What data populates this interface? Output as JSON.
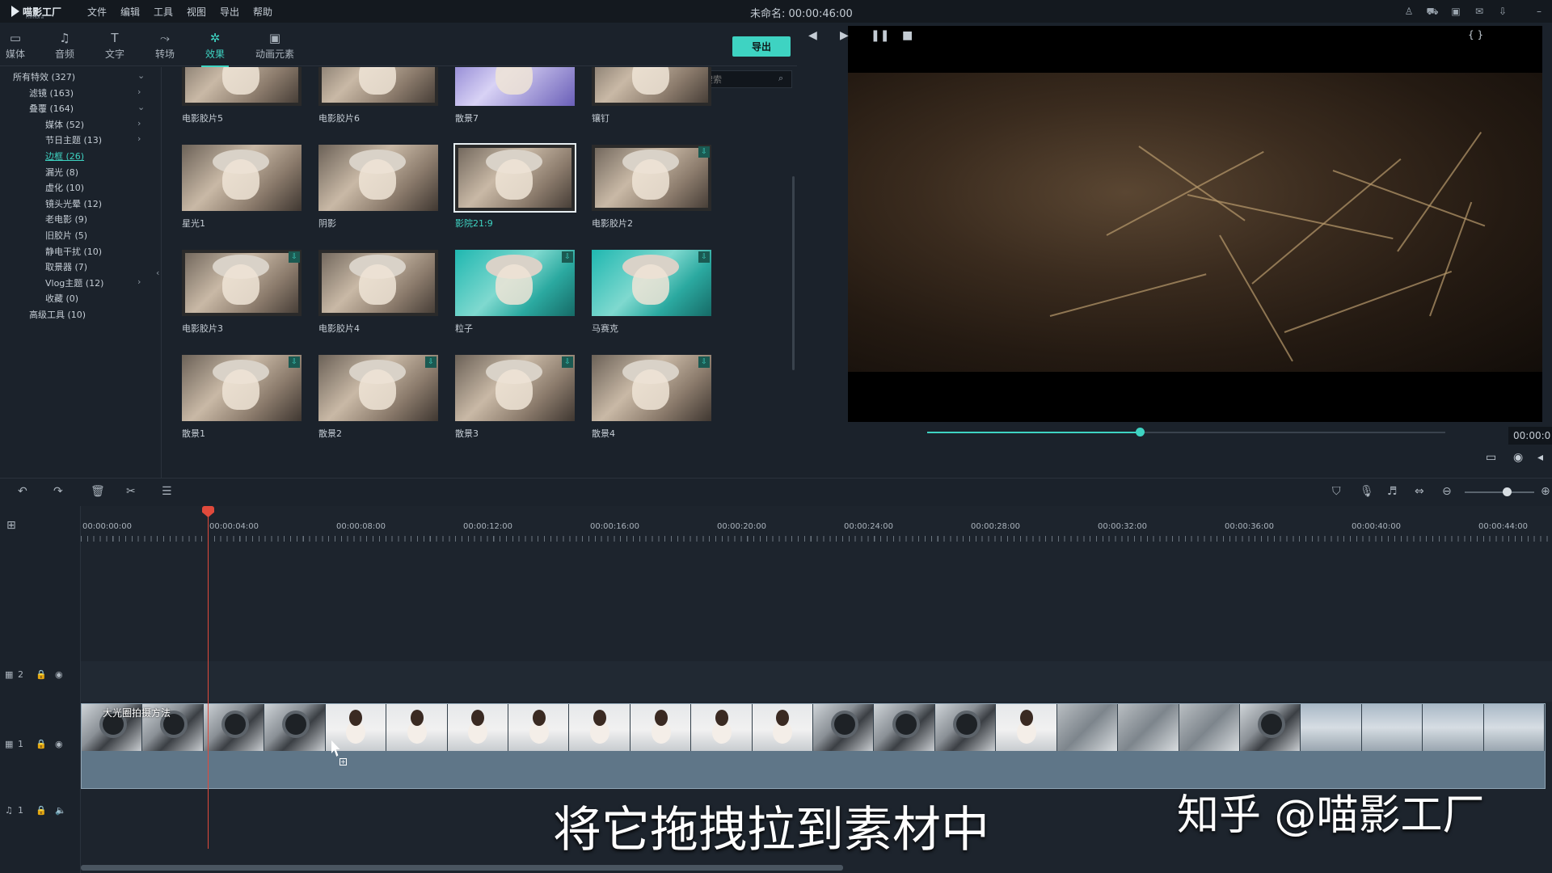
{
  "app": {
    "logo_text": "喵影工厂",
    "logo_sub": "Filmora"
  },
  "menu": [
    "文件",
    "编辑",
    "工具",
    "视图",
    "导出",
    "帮助"
  ],
  "doc_title": "未命名: 00:00:46:00",
  "toolbar": {
    "tools": [
      {
        "label": "媒体",
        "icon": "▭"
      },
      {
        "label": "音频",
        "icon": "♫"
      },
      {
        "label": "文字",
        "icon": "T"
      },
      {
        "label": "转场",
        "icon": "⤳"
      },
      {
        "label": "效果",
        "icon": "✲"
      },
      {
        "label": "动画元素",
        "icon": "▣"
      }
    ],
    "active_tool": "效果",
    "export_label": "导出"
  },
  "sidebar": {
    "categories": [
      {
        "label": "所有特效 (327)",
        "chevron": "⌄"
      },
      {
        "label": "滤镜 (163)",
        "chevron": "›"
      },
      {
        "label": "叠覆 (164)",
        "chevron": "⌄"
      },
      {
        "label": "媒体 (52)",
        "chevron": "›"
      },
      {
        "label": "节日主题 (13)",
        "chevron": "›"
      },
      {
        "label": "边框 (26)",
        "chevron": ""
      },
      {
        "label": "漏光 (8)",
        "chevron": ""
      },
      {
        "label": "虚化 (10)",
        "chevron": ""
      },
      {
        "label": "镜头光晕 (12)",
        "chevron": ""
      },
      {
        "label": "老电影 (9)",
        "chevron": ""
      },
      {
        "label": "旧胶片 (5)",
        "chevron": ""
      },
      {
        "label": "静电干扰 (10)",
        "chevron": ""
      },
      {
        "label": "取景器 (7)",
        "chevron": ""
      },
      {
        "label": "Vlog主题 (12)",
        "chevron": "›"
      },
      {
        "label": "收藏 (0)",
        "chevron": ""
      },
      {
        "label": "高级工具 (10)",
        "chevron": ""
      }
    ],
    "selected": "边框 (26)"
  },
  "grid": {
    "search_placeholder": "搜索",
    "items": [
      {
        "label": "电影胶片5",
        "style": "frame",
        "download": false
      },
      {
        "label": "电影胶片6",
        "style": "frame",
        "download": false
      },
      {
        "label": "散景7",
        "style": "bokeh",
        "download": false
      },
      {
        "label": "镶钉",
        "style": "frame",
        "download": false
      },
      {
        "label": "星光1",
        "style": "plain",
        "download": false
      },
      {
        "label": "阴影",
        "style": "plain",
        "download": false
      },
      {
        "label": "影院21:9",
        "style": "selected",
        "download": false
      },
      {
        "label": "电影胶片2",
        "style": "frame",
        "download": true
      },
      {
        "label": "电影胶片3",
        "style": "frame",
        "download": true
      },
      {
        "label": "电影胶片4",
        "style": "frame",
        "download": false
      },
      {
        "label": "粒子",
        "style": "teal",
        "download": true
      },
      {
        "label": "马赛克",
        "style": "teal",
        "download": true
      },
      {
        "label": "散景1",
        "style": "plain",
        "download": true
      },
      {
        "label": "散景2",
        "style": "plain",
        "download": true
      },
      {
        "label": "散景3",
        "style": "plain",
        "download": true
      },
      {
        "label": "散景4",
        "style": "plain",
        "download": true
      }
    ],
    "active_label": "影院21:9"
  },
  "preview": {
    "progress": 0.41,
    "timecode": "00:00:0"
  },
  "timeline": {
    "ruler_labels": [
      "00:00:00:00",
      "00:00:04:00",
      "00:00:08:00",
      "00:00:12:00",
      "00:00:16:00",
      "00:00:20:00",
      "00:00:24:00",
      "00:00:28:00",
      "00:00:32:00",
      "00:00:36:00",
      "00:00:40:00",
      "00:00:44:00"
    ],
    "tracks": [
      {
        "label": "2",
        "type": "video"
      },
      {
        "label": "1",
        "type": "video"
      },
      {
        "label": "1",
        "type": "audio"
      }
    ],
    "clip_title": "大光圈拍摄方法",
    "zoom": 0.6
  },
  "overlay": {
    "subtitle": "将它拖拽拉到素材中",
    "watermark": "知乎 @喵影工厂"
  },
  "colors": {
    "accent": "#3ed3c2",
    "playhead": "#e04a3c",
    "panel": "#1b222b"
  }
}
